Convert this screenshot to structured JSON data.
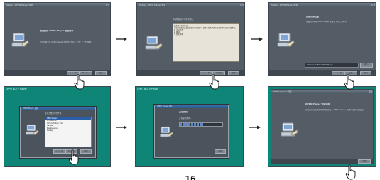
{
  "steps": [
    {
      "title": "Setup - OPPO Player 安装",
      "heading": "欢迎使用 OPPO Player 安装向导",
      "body": "此程序将安装 OPPO Player 到您的计算机。点击“下一步”继续。",
      "buttons": [
        "< 上一步",
        "下一步 >",
        "取消"
      ]
    },
    {
      "title": "Setup - OPPO Player 安装",
      "heading": "请仔细阅读以下许可协议。",
      "license": "最终用户许可协议\n本软件受版权法及国际版权条约保护。使用本软件即表示您同意本协议的全部条款。\n1. 许可授予\n2. 限制\n3. 免责声明",
      "buttons": [
        "< 上一步",
        "我同意",
        "取消"
      ]
    },
    {
      "title": "Setup - OPPO Player 安装",
      "heading": "选择目标位置",
      "body": "安装程序将把 OPPO Player 安装到下列文件夹中。",
      "path": "C:\\Program Files\\OPPO Player",
      "browse": "浏览...",
      "buttons": [
        "< 上一步",
        "安装",
        "取消"
      ]
    },
    {
      "desktop_label": "OPPO NDTV Player",
      "title": "OPPO Player 安装",
      "heading": "选择开始菜单文件夹",
      "list": [
        "OPPO Player",
        "Accessories",
        "Administrative Tools",
        "Games",
        "Maintenance",
        "Startup"
      ],
      "buttons": [
        "< 上一步",
        "下一步 >",
        "取消"
      ]
    },
    {
      "desktop_label": "OPPO NDTV Player",
      "title": "OPPO Player 安装",
      "heading": "正在安装",
      "status": "正在复制文件...",
      "progress": 0.55,
      "buttons": [
        "取消"
      ]
    },
    {
      "title": "OPPO Player 安装",
      "heading": "OPPO Player 安装完成",
      "body": "安装程序已在您的计算机中安装了 OPPO Player。点击“完成”退出安装。",
      "buttons": [
        "完成"
      ]
    }
  ],
  "icons": {
    "arrow": "right-arrow-icon",
    "hand": "pointing-hand-cursor-icon",
    "installer": "installer-computer-icon"
  },
  "colors": {
    "panel_gray": "#545c66",
    "desktop_teal": "#0f8578",
    "dialog_title": "#3a6ea5"
  },
  "page_number": "16"
}
